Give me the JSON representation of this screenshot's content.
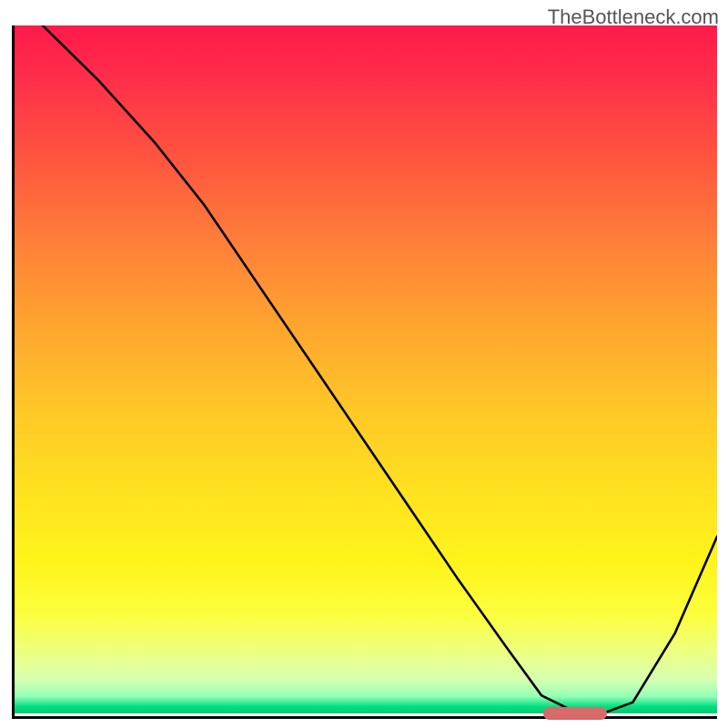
{
  "watermark": "TheBottleneck.com",
  "chart_data": {
    "type": "line",
    "title": "",
    "xlabel": "",
    "ylabel": "",
    "xlim": [
      0,
      100
    ],
    "ylim": [
      0,
      100
    ],
    "grid": false,
    "legend": false,
    "series": [
      {
        "name": "bottleneck-curve",
        "x": [
          4,
          12,
          20,
          27,
          35,
          45,
          55,
          63,
          70,
          75,
          80,
          84,
          88,
          94,
          100
        ],
        "values": [
          100,
          92,
          83,
          74,
          62,
          47,
          32,
          20,
          10,
          3,
          0.5,
          0.5,
          2,
          12,
          26
        ]
      }
    ],
    "marker": {
      "x_start": 75,
      "x_end": 84,
      "y": 0.5
    },
    "gradient_stops": [
      {
        "pos": 0,
        "color": "#ff1a4a"
      },
      {
        "pos": 0.5,
        "color": "#ffc528"
      },
      {
        "pos": 0.9,
        "color": "#fcff40"
      },
      {
        "pos": 1.0,
        "color": "#00c870"
      }
    ]
  }
}
